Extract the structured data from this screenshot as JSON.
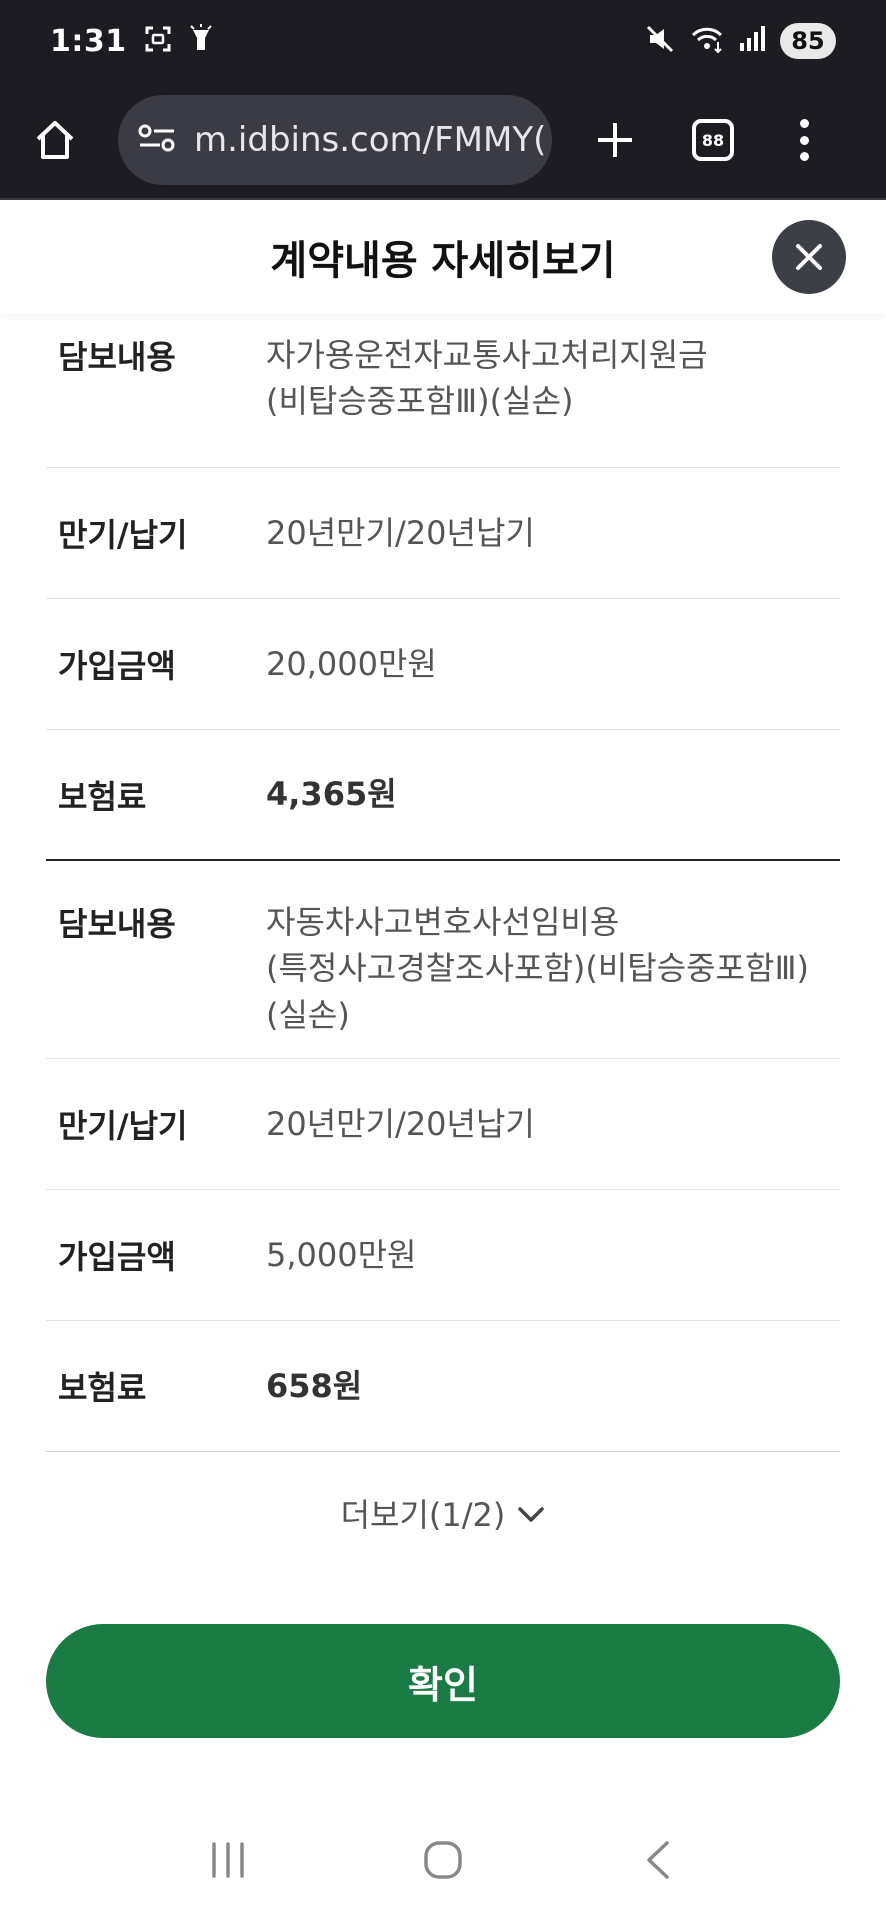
{
  "status_bar": {
    "time": "1:31",
    "battery": "85",
    "icons": [
      "screenshot-icon",
      "flashlight-icon",
      "mute-icon",
      "wifi-icon",
      "signal-icon"
    ]
  },
  "browser": {
    "url": "m.idbins.com/FMMY(",
    "tab_count": "88"
  },
  "modal": {
    "title": "계약내용 자세히보기"
  },
  "coverages": [
    {
      "label_coverage": "담보내용",
      "coverage": "자가용운전자교통사고처리지원금(비탑승중포함Ⅲ)(실손)",
      "label_term": "만기/납기",
      "term": "20년만기/20년납기",
      "label_amount": "가입금액",
      "amount": "20,000만원",
      "label_premium": "보험료",
      "premium": "4,365원"
    },
    {
      "label_coverage": "담보내용",
      "coverage": "자동차사고변호사선임비용(특정사고경찰조사포함)(비탑승중포함Ⅲ)(실손)",
      "label_term": "만기/납기",
      "term": "20년만기/20년납기",
      "label_amount": "가입금액",
      "amount": "5,000만원",
      "label_premium": "보험료",
      "premium": "658원"
    }
  ],
  "more": {
    "label": "더보기(1/2)"
  },
  "confirm": {
    "label": "확인"
  },
  "colors": {
    "primary": "#1a7b44",
    "status_bg": "#1c1c22",
    "close_bg": "#3c4046"
  }
}
